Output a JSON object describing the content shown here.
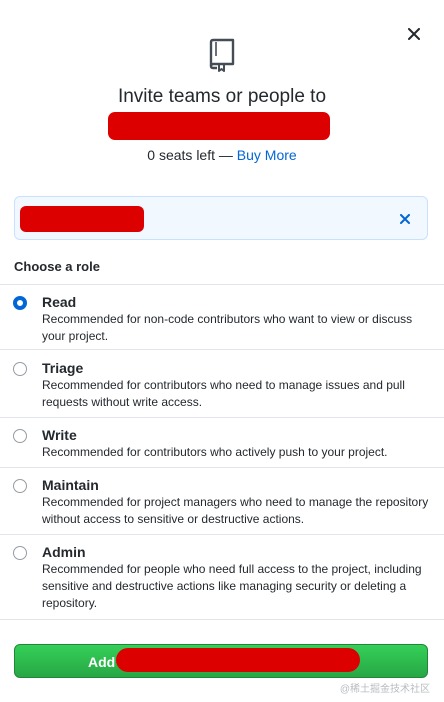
{
  "dialog": {
    "title": "Invite teams or people to",
    "seats_text": "0 seats left — ",
    "buy_more_label": "Buy More"
  },
  "role_section": {
    "heading": "Choose a role",
    "selected": "Read",
    "roles": [
      {
        "name": "Read",
        "description": "Recommended for non-code contributors who want to view or discuss your project.",
        "checked": true
      },
      {
        "name": "Triage",
        "description": "Recommended for contributors who need to manage issues and pull requests without write access.",
        "checked": false
      },
      {
        "name": "Write",
        "description": "Recommended for contributors who actively push to your project.",
        "checked": false
      },
      {
        "name": "Maintain",
        "description": "Recommended for project managers who need to manage the repository without access to sensitive or destructive actions.",
        "checked": false
      },
      {
        "name": "Admin",
        "description": "Recommended for people who need full access to the project, including sensitive and destructive actions like managing security or deleting a repository.",
        "checked": false
      }
    ]
  },
  "footer": {
    "add_label": "Add"
  },
  "watermark": "@稀土掘金技术社区",
  "icons": {
    "close": "close-icon",
    "repo": "repo-icon",
    "clear": "clear-x-icon"
  },
  "colors": {
    "link": "#0366d6",
    "primary_button": "#2ea44f",
    "redaction": "#dd0000",
    "selected_bg": "#f1f8ff"
  }
}
